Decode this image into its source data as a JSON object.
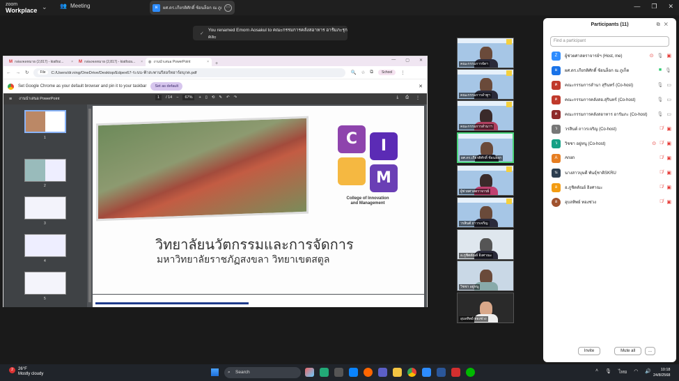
{
  "zoom": {
    "logo_line1": "zoom",
    "logo_line2": "Workplace",
    "meeting_label": "Meeting",
    "tab_name": "ผศ.ดร.เกียรติศักดิ์ ช้อนล็อก ณ ภูเก็ต",
    "toast": "You renamed Emorn Aosakul to คณะกรรมการคลังสอาหาร อารัมภะรุกคละ"
  },
  "browser": {
    "tabs": [
      {
        "label": "กล่องจดหมาย (2,817) - kiatfoz..."
      },
      {
        "label": "กล่องจดหมาย (2,817) - kiatfoza..."
      },
      {
        "label": "งานนำเสนอ PowerPoint"
      }
    ],
    "url_chip": "File",
    "url": "C:/Users/dr.ning/OneDrive/Desktop/Edpex67-ระบบ-ฟ้าสะพานรีสอร์ทฮาร์ดบุกค.pdf",
    "profile": "School",
    "infobar_text": "Set Google Chrome as your default browser and pin it to your taskbar",
    "set_default": "Set as default"
  },
  "pdf": {
    "title": "งานนำเสนอ PowerPoint",
    "page_current": "1",
    "page_total": "/ 14",
    "zoom": "67%",
    "thumbs": [
      "1",
      "2",
      "3",
      "4",
      "5"
    ]
  },
  "slide": {
    "letters": [
      "C",
      "I",
      "",
      "M"
    ],
    "college_line1": "College of Innovation",
    "college_line2": "and Management",
    "thai_title": "วิทยาลัยนวัตกรรมและการจัดการ",
    "thai_sub": "มหาวิทยาลัยราชภัฏสงขลา วิทยาเขตสตูล"
  },
  "videos": [
    {
      "name": "คณะกรรมการจัดฯ"
    },
    {
      "name": "คณะกรรมการลำพูฯ"
    },
    {
      "name": "คณะกรรมการลำนาฯ"
    },
    {
      "name": "ผศ.ดร.เกียรติศักดิ์ ช้อนล็อก"
    },
    {
      "name": "ผู้ช่วยศาสตราจารย์"
    },
    {
      "name": "วรสินต์ ถาวรเจริญ"
    },
    {
      "name": "อ.ภูชิตตัณย์ อิงศาณะ"
    },
    {
      "name": "วิชชา อยู่หนู"
    },
    {
      "name": "อุบลทิพย์ ทองช่วง"
    }
  ],
  "participants": {
    "title": "Participants (11)",
    "search_placeholder": "Find a participant",
    "list": [
      {
        "initial": "Z",
        "color": "#2d8cff",
        "name": "ผู้ช่วยศาสตราจารย์ฯ (Host, me)"
      },
      {
        "initial": "ผ",
        "color": "#1a73e8",
        "name": "ผศ.ดร.เกียรติศักดิ์ ช้อนล็อก ณ ภูเก็ต"
      },
      {
        "initial": "ค",
        "color": "#c0392b",
        "name": "คณะกรรมการลำนา สุรินทร์ (Co-host)"
      },
      {
        "initial": "ค",
        "color": "#c0392b",
        "name": "คณะกรรมการคลังสอ.สุรินทร์ (Co-host)"
      },
      {
        "initial": "ค",
        "color": "#8e2a2a",
        "name": "คณะกรรมการคลังสอาหาร อารัมภะ (Co-host)"
      },
      {
        "initial": "ว",
        "color": "#777777",
        "name": "วรสินต์ ถาวรเจริญ (Co-host)"
      },
      {
        "initial": "ว",
        "color": "#16a085",
        "name": "วิชชา อยู่หนู (Co-host)"
      },
      {
        "initial": "A",
        "color": "#e67e22",
        "name": "Anan"
      },
      {
        "initial": "น",
        "color": "#2c3e50",
        "name": "นางสาวบุษดี พันธุ์ชาติSKRU"
      },
      {
        "initial": "อ",
        "color": "#f39c12",
        "name": "อ.ภูชิตตัณย์ อิงศาณะ"
      },
      {
        "initial": "อ",
        "color": "#a0522d",
        "name": "อุบลทิพย์ ทองช่วง"
      }
    ],
    "invite": "Invite",
    "mute_all": "Mute all",
    "more": "..."
  },
  "taskbar": {
    "badge": "2",
    "temp": "26°F",
    "weather": "Mostly cloudy",
    "search": "Search",
    "lang": "ไทย",
    "time": "10:18",
    "date": "24/8/2568"
  }
}
